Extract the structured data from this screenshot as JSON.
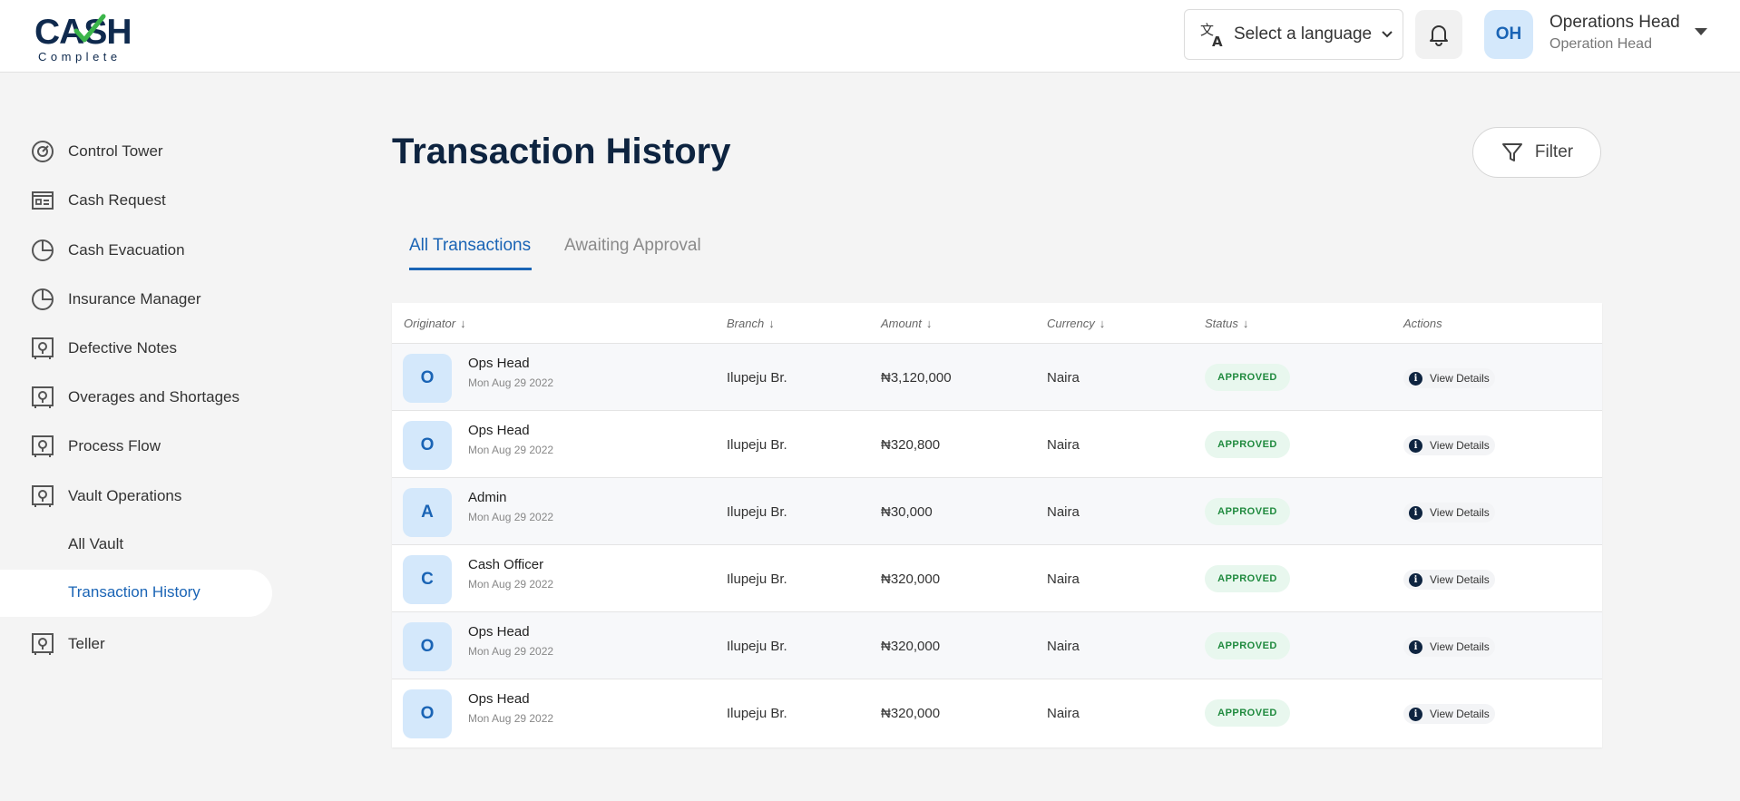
{
  "brand": {
    "logo_top": "CASH",
    "logo_sub": "Complete",
    "accent": "#1a64b5",
    "check_color": "#3bb54a",
    "dark": "#0e2440"
  },
  "header": {
    "language_label": "Select a language",
    "user_initials": "OH",
    "user_name": "Operations Head",
    "user_role": "Operation Head"
  },
  "sidebar": {
    "items": [
      {
        "label": "Control Tower",
        "icon": "gauge-icon"
      },
      {
        "label": "Cash Request",
        "icon": "id-card-icon"
      },
      {
        "label": "Cash Evacuation",
        "icon": "pie-chart-icon"
      },
      {
        "label": "Insurance Manager",
        "icon": "pie-chart-icon"
      },
      {
        "label": "Defective Notes",
        "icon": "safe-icon"
      },
      {
        "label": "Overages and Shortages",
        "icon": "safe-icon"
      },
      {
        "label": "Process Flow",
        "icon": "safe-icon"
      },
      {
        "label": "Vault Operations",
        "icon": "safe-icon"
      },
      {
        "label": "Teller",
        "icon": "safe-icon"
      }
    ],
    "subitems": [
      {
        "label": "All Vault"
      },
      {
        "label": "Transaction History",
        "active": true
      }
    ]
  },
  "main": {
    "title": "Transaction History",
    "filter_label": "Filter",
    "tabs": [
      {
        "label": "All Transactions",
        "active": true
      },
      {
        "label": "Awaiting Approval",
        "active": false
      }
    ],
    "table": {
      "columns": [
        "Originator",
        "Branch",
        "Amount",
        "Currency",
        "Status",
        "Actions"
      ],
      "rows": [
        {
          "initial": "O",
          "name": "Ops Head",
          "date": "Mon Aug 29 2022",
          "branch": "Ilupeju Br.",
          "amount": "₦3,120,000",
          "currency": "Naira",
          "status": "APPROVED",
          "action": "View Details"
        },
        {
          "initial": "O",
          "name": "Ops Head",
          "date": "Mon Aug 29 2022",
          "branch": "Ilupeju Br.",
          "amount": "₦320,800",
          "currency": "Naira",
          "status": "APPROVED",
          "action": "View Details"
        },
        {
          "initial": "A",
          "name": "Admin",
          "date": "Mon Aug 29 2022",
          "branch": "Ilupeju Br.",
          "amount": "₦30,000",
          "currency": "Naira",
          "status": "APPROVED",
          "action": "View Details"
        },
        {
          "initial": "C",
          "name": "Cash Officer",
          "date": "Mon Aug 29 2022",
          "branch": "Ilupeju Br.",
          "amount": "₦320,000",
          "currency": "Naira",
          "status": "APPROVED",
          "action": "View Details"
        },
        {
          "initial": "O",
          "name": "Ops Head",
          "date": "Mon Aug 29 2022",
          "branch": "Ilupeju Br.",
          "amount": "₦320,000",
          "currency": "Naira",
          "status": "APPROVED",
          "action": "View Details"
        },
        {
          "initial": "O",
          "name": "Ops Head",
          "date": "Mon Aug 29 2022",
          "branch": "Ilupeju Br.",
          "amount": "₦320,000",
          "currency": "Naira",
          "status": "APPROVED",
          "action": "View Details"
        }
      ]
    }
  }
}
